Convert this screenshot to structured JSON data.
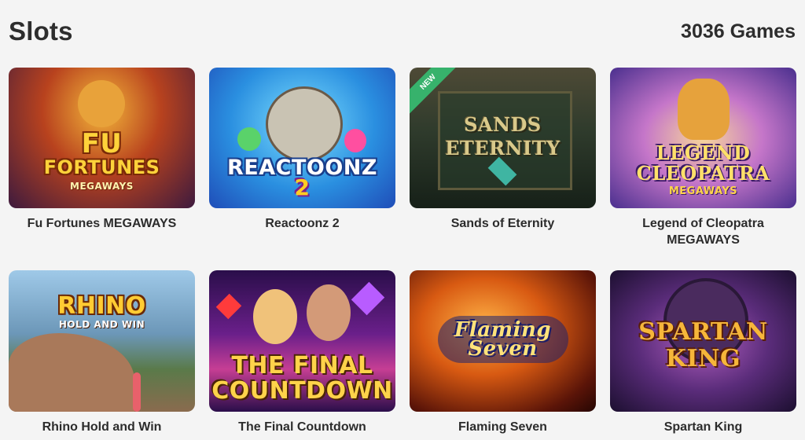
{
  "header": {
    "title": "Slots",
    "games_count": "3036 Games"
  },
  "games": [
    {
      "name": "Fu Fortunes MEGAWAYS",
      "logo_line1": "FU",
      "logo_line2": "FORTUNES",
      "logo_sub": "MEGAWAYS"
    },
    {
      "name": "Reactoonz 2",
      "logo_line1": "REACTOONZ",
      "logo_line2": "2"
    },
    {
      "name": "Sands of Eternity",
      "logo_line1": "SANDS",
      "logo_line2": "ETERNITY",
      "badge": "NEW"
    },
    {
      "name": "Legend of Cleopatra MEGAWAYS",
      "logo_line1": "LEGEND",
      "logo_line2": "CLEOPATRA",
      "logo_sub": "MEGAWAYS"
    },
    {
      "name": "Rhino Hold and Win",
      "logo_line1": "RHINO",
      "logo_sub": "HOLD AND WIN"
    },
    {
      "name": "The Final Countdown",
      "logo_line1": "THE FINAL",
      "logo_line2": "COUNTDOWN"
    },
    {
      "name": "Flaming Seven",
      "logo_line1": "Flaming",
      "logo_line2": "Seven"
    },
    {
      "name": "Spartan King",
      "logo_line1": "SPARTAN",
      "logo_line2": "KING"
    }
  ],
  "colors": {
    "background": "#f4f4f4",
    "text": "#2d2d2d",
    "new_badge": "#37b26c"
  }
}
